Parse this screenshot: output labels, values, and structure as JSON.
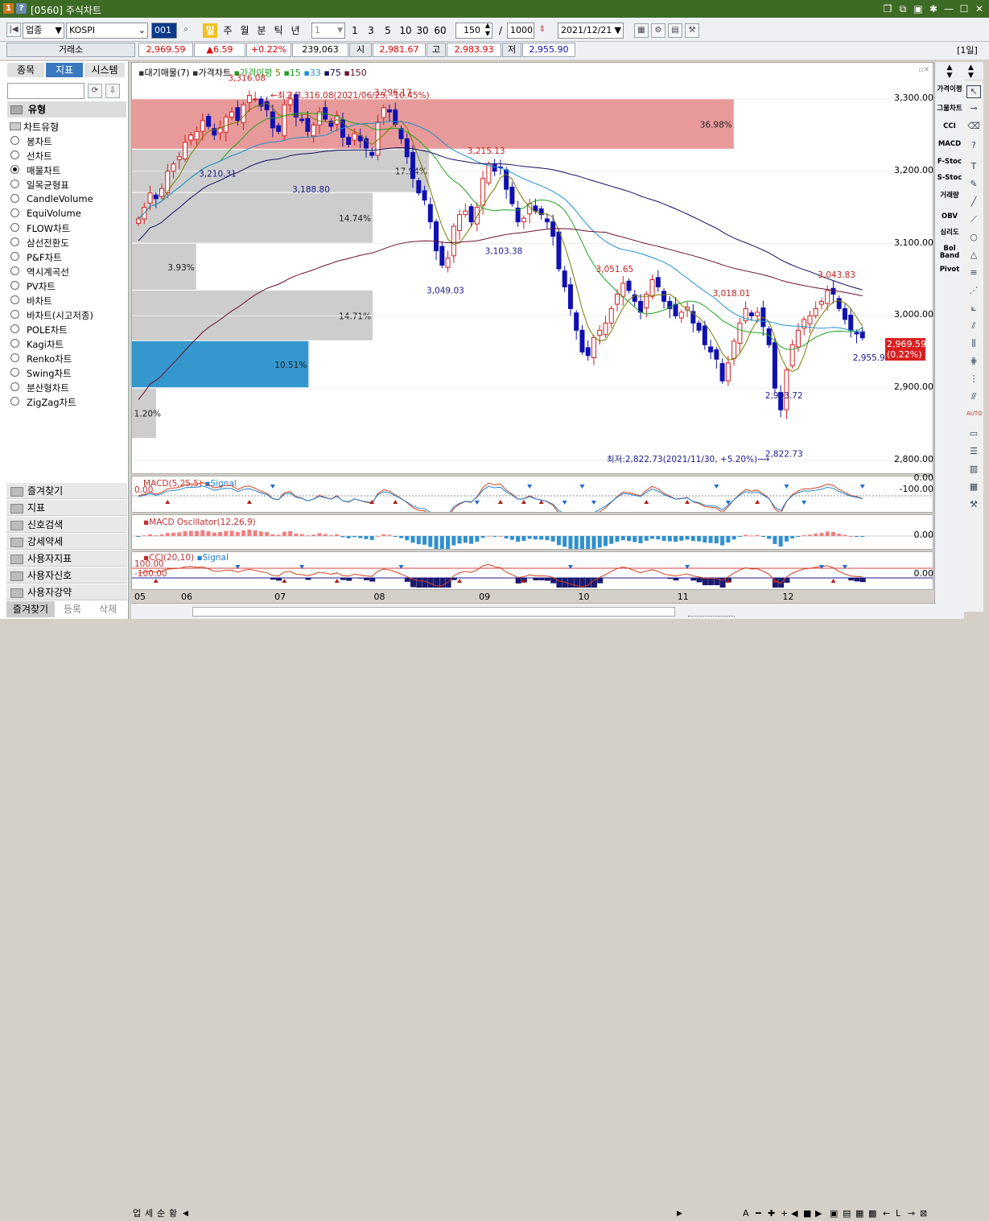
{
  "window": {
    "icon_a": "1",
    "icon_b": "?",
    "title": "[0560] 주식차트",
    "controls": [
      "copy-icon",
      "link-icon",
      "save-icon",
      "settings-icon",
      "minimize-icon",
      "maximize-icon",
      "close-icon"
    ]
  },
  "toolbar": {
    "market": "업종",
    "symbol": "KOSPI",
    "code": "001",
    "periods": [
      "일",
      "주",
      "월",
      "분",
      "틱",
      "년"
    ],
    "active_period": "일",
    "unit_value": "1",
    "unit_buttons": [
      "1",
      "3",
      "5",
      "10",
      "30",
      "60"
    ],
    "count": "150",
    "slash": "/",
    "max_count": "1000",
    "date": "2021/12/21"
  },
  "price_bar": {
    "exchange": "거래소",
    "last": "2,969.59",
    "change": "▲6.59",
    "pct": "+0.22%",
    "volume": "239,063",
    "open_label": "시",
    "open": "2,981.67",
    "high_label": "고",
    "high": "2,983.93",
    "low_label": "저",
    "low": "2,955.90",
    "interval": "[1일]"
  },
  "left_panel": {
    "tabs": [
      "종목",
      "지표",
      "시스템"
    ],
    "active_tab": "지표",
    "section": "유형",
    "group": "차트유형",
    "chart_types": [
      "봉차트",
      "선차트",
      "매물차트",
      "일목균형표",
      "CandleVolume",
      "EquiVolume",
      "FLOW차트",
      "삼선전환도",
      "P&F차트",
      "역시계곡선",
      "PV차트",
      "바차트",
      "바차트(시고저종)",
      "POLE차트",
      "Kagi차트",
      "Renko차트",
      "Swing차트",
      "분산형차트",
      "ZigZag차트"
    ],
    "selected": "매물차트",
    "groups": [
      "즐겨찾기",
      "지표",
      "신호검색",
      "강세약세",
      "사용자지표",
      "사용자신호",
      "사용자강약"
    ],
    "footer": {
      "fav": "즐겨찾기",
      "reg": "등록",
      "del": "삭제"
    }
  },
  "legend": {
    "main": "대기매물(7)",
    "price": "가격차트",
    "ma_label": "가격이평",
    "ma": [
      "5",
      "15",
      "33",
      "75",
      "150"
    ]
  },
  "colors": {
    "up": "#d01f1f",
    "down": "#1010b0",
    "ma5": "#7a7a00",
    "ma15": "#20a020",
    "ma33": "#2090d0",
    "ma75": "#101060",
    "ma150": "#6a1030",
    "volbar": "#c8c8c8",
    "volhigh": "#e07878",
    "volblue": "#1e8cc8"
  },
  "chart_data": {
    "type": "candlestick",
    "ylim": [
      2780,
      3350
    ],
    "yticks": [
      2800,
      2900,
      3000,
      3100,
      3200,
      3300
    ],
    "ytick_labels": [
      "2,800.00",
      "2,900.00",
      "3,000.00",
      "3,100.00",
      "3,200.00",
      "3,300.00"
    ],
    "x_labels": [
      "05",
      "06",
      "07",
      "08",
      "09",
      "10",
      "11",
      "12"
    ],
    "annotations": {
      "high_note": "←최고:3,316.08(2021/06/25, -10.45%)",
      "low_note": "최저:2,822.73(2021/11/30, +5.20%)⟶",
      "peak_labels": [
        "3,316.08",
        "3,296.17",
        "3,215.13",
        "3,051.65",
        "3,018.01",
        "3,043.83"
      ],
      "trough_labels": [
        "3,210.31",
        "3,188.80",
        "3,049.03",
        "3,103.38",
        "2,903.72",
        "2,822.73",
        "2,955.90"
      ]
    },
    "last_price": "2,969.59",
    "last_pct": "(0.22%)",
    "volume_profile": [
      {
        "pct": "36.98%",
        "from": 3230,
        "to": 3300,
        "size": 0.75,
        "highlight": true
      },
      {
        "pct": "17.94%",
        "from": 3170,
        "to": 3230,
        "size": 0.37
      },
      {
        "pct": "14.74%",
        "from": 3100,
        "to": 3170,
        "size": 0.3
      },
      {
        "pct": "3.93%",
        "from": 3035,
        "to": 3100,
        "size": 0.08
      },
      {
        "pct": "14.71%",
        "from": 2965,
        "to": 3035,
        "size": 0.3
      },
      {
        "pct": "10.51%",
        "from": 2900,
        "to": 2965,
        "size": 0.22,
        "blue": true
      },
      {
        "pct": "1.20%",
        "from": 2830,
        "to": 2900,
        "size": 0.03
      }
    ],
    "close": [
      3134,
      3150,
      3170,
      3162,
      3176,
      3200,
      3210,
      3220,
      3240,
      3250,
      3255,
      3270,
      3262,
      3250,
      3260,
      3275,
      3282,
      3270,
      3292,
      3305,
      3300,
      3290,
      3285,
      3260,
      3255,
      3292,
      3300,
      3275,
      3270,
      3255,
      3264,
      3282,
      3272,
      3262,
      3277,
      3247,
      3237,
      3252,
      3242,
      3232,
      3222,
      3268,
      3288,
      3282,
      3265,
      3245,
      3220,
      3190,
      3170,
      3160,
      3130,
      3090,
      3070,
      3080,
      3124,
      3140,
      3145,
      3130,
      3150,
      3190,
      3210,
      3200,
      3205,
      3175,
      3155,
      3130,
      3135,
      3155,
      3145,
      3140,
      3130,
      3110,
      3065,
      3040,
      3010,
      2980,
      2950,
      2945,
      2970,
      2980,
      2990,
      3010,
      3030,
      3045,
      3035,
      3020,
      3005,
      3030,
      3050,
      3040,
      3020,
      3010,
      3000,
      3005,
      3012,
      2990,
      2980,
      2960,
      2950,
      2940,
      2910,
      2935,
      2965,
      2990,
      3010,
      3000,
      3005,
      2985,
      2960,
      2900,
      2870,
      2925,
      2960,
      2980,
      2995,
      3000,
      3010,
      3020,
      3035,
      3030,
      3010,
      2995,
      2980,
      2975,
      2969.59
    ],
    "macd": {
      "label": "MACD(5,25,5)",
      "signal": "Signal",
      "yticks": [
        "0.00",
        "-100.00"
      ],
      "left_label": "0.00"
    },
    "osc": {
      "label": "MACD Oscillator(12,26,9)",
      "ytick": "0.00"
    },
    "cci": {
      "label": "CCI(20,10)",
      "signal": "Signal",
      "yticks": [
        "0.00"
      ],
      "left_labels": [
        "100.00",
        "-100.00"
      ]
    }
  },
  "right_tools": [
    "가격이평",
    "그물차트",
    "CCI",
    "MACD",
    "F-Stoc",
    "S-Stoc",
    "거래량",
    "OBV",
    "심리도",
    "Bol Band",
    "Pivot"
  ],
  "bottom_bar": {
    "tabs": [
      "업",
      "세",
      "순",
      "황"
    ],
    "letter": "A"
  }
}
